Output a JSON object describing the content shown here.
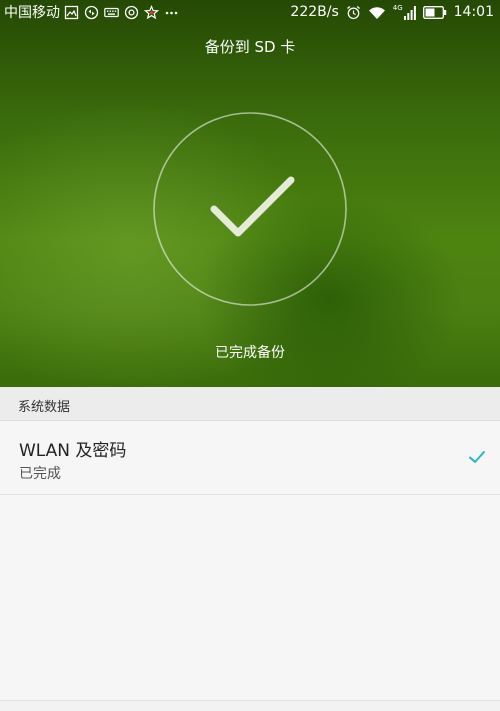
{
  "status_bar": {
    "carrier": "中国移动",
    "left_icons": [
      "image-icon",
      "sync-icon",
      "keyboard-icon",
      "settings-icon",
      "star-icon",
      "more-icon"
    ],
    "speed": "222B/s",
    "network_type": "4G",
    "time": "14:01"
  },
  "hero": {
    "title": "备份到 SD 卡",
    "status": "已完成备份"
  },
  "section": {
    "header": "系统数据"
  },
  "items": [
    {
      "title": "WLAN 及密码",
      "status": "已完成"
    }
  ],
  "colors": {
    "accent_check": "#29b6c8",
    "hero_green": "#4d8410"
  }
}
